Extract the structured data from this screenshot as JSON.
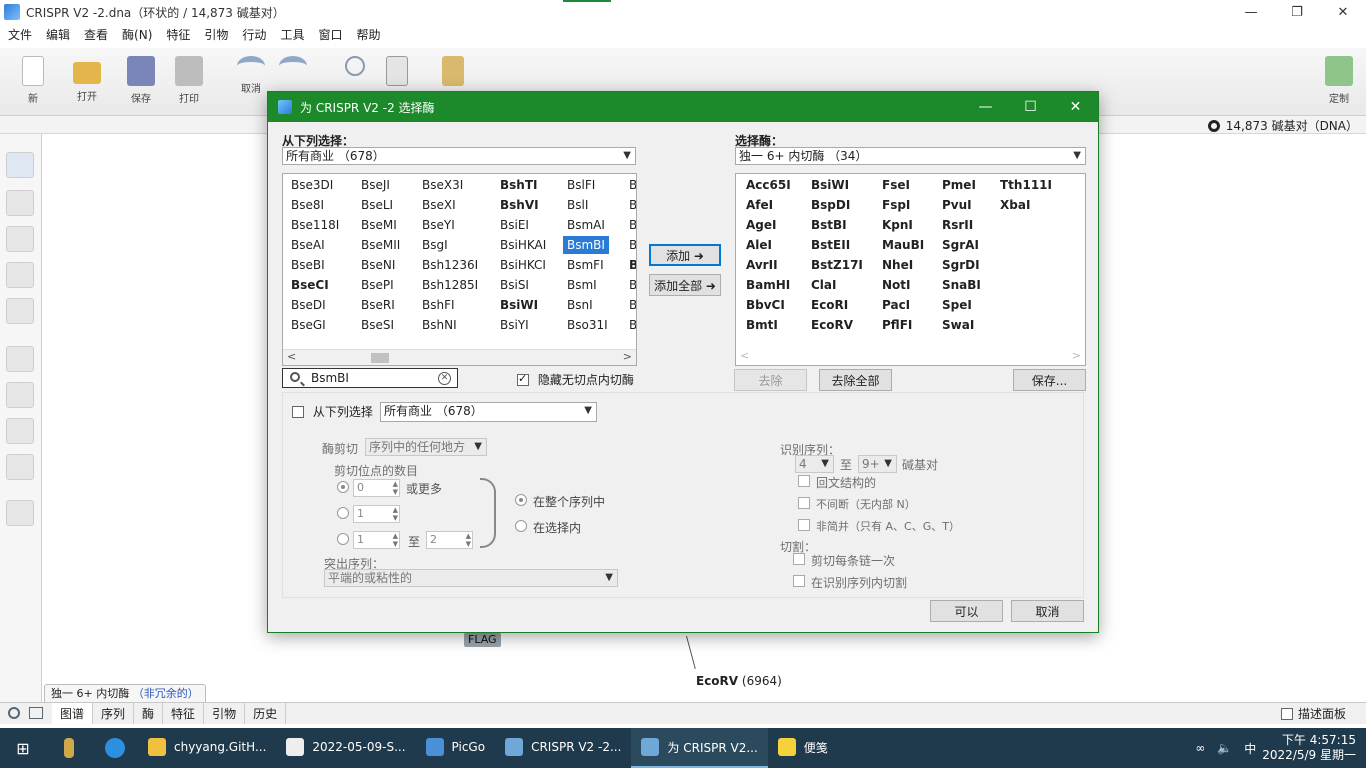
{
  "app": {
    "title": "CRISPR V2 -2.dna（环状的 / 14,873 碱基对）",
    "window_buttons": [
      "—",
      "❐",
      "✕"
    ]
  },
  "menu": [
    "文件",
    "编辑",
    "查看",
    "酶(N)",
    "特征",
    "引物",
    "行动",
    "工具",
    "窗口",
    "帮助"
  ],
  "toolbar": {
    "new": "新",
    "open": "打开",
    "save": "保存",
    "print": "打印",
    "undo": "取消",
    "redo": "",
    "cut": "",
    "copy": "",
    "paste": "",
    "customize": "定制"
  },
  "status": {
    "bp": "14,873 碱基对（DNA）"
  },
  "map": {
    "flag_label": "FLAG",
    "ecorv_name": "EcoRV",
    "ecorv_pos": "(6964)"
  },
  "enzyme_filter": {
    "text": "独一 6+ 内切酶",
    "link": "（非冗余的）"
  },
  "view_tabs": [
    "图谱",
    "序列",
    "酶",
    "特征",
    "引物",
    "历史"
  ],
  "describe_panel": "描述面板",
  "dialog": {
    "title": "为 CRISPR V2 -2 选择酶",
    "left_label": "从下列选择：",
    "left_combo": "所有商业  （678）",
    "right_label": "选择酶：",
    "right_combo": "独一 6+ 内切酶  （34）",
    "left_grid": [
      [
        {
          "t": "Bse3DI",
          "b": false
        },
        {
          "t": "BseJI",
          "b": false
        },
        {
          "t": "BseX3I",
          "b": false
        },
        {
          "t": "BshTI",
          "b": true
        },
        {
          "t": "BslFI",
          "b": false
        },
        {
          "t": "B",
          "b": false
        }
      ],
      [
        {
          "t": "Bse8I",
          "b": false
        },
        {
          "t": "BseLI",
          "b": false
        },
        {
          "t": "BseXI",
          "b": false
        },
        {
          "t": "BshVI",
          "b": true
        },
        {
          "t": "BslI",
          "b": false
        },
        {
          "t": "B",
          "b": false
        }
      ],
      [
        {
          "t": "Bse118I",
          "b": false
        },
        {
          "t": "BseMI",
          "b": false
        },
        {
          "t": "BseYI",
          "b": false
        },
        {
          "t": "BsiEI",
          "b": false
        },
        {
          "t": "BsmAI",
          "b": false
        },
        {
          "t": "B",
          "b": false
        }
      ],
      [
        {
          "t": "BseAI",
          "b": false
        },
        {
          "t": "BseMII",
          "b": false
        },
        {
          "t": "BsgI",
          "b": false
        },
        {
          "t": "BsiHKAI",
          "b": false
        },
        {
          "t": "BsmBI",
          "b": false,
          "sel": true
        },
        {
          "t": "B",
          "b": false
        }
      ],
      [
        {
          "t": "BseBI",
          "b": false
        },
        {
          "t": "BseNI",
          "b": false
        },
        {
          "t": "Bsh1236I",
          "b": false
        },
        {
          "t": "BsiHKCI",
          "b": false
        },
        {
          "t": "BsmFI",
          "b": false
        },
        {
          "t": "B",
          "b": true
        }
      ],
      [
        {
          "t": "BseCI",
          "b": true
        },
        {
          "t": "BsePI",
          "b": false
        },
        {
          "t": "Bsh1285I",
          "b": false
        },
        {
          "t": "BsiSI",
          "b": false
        },
        {
          "t": "BsmI",
          "b": false
        },
        {
          "t": "B",
          "b": false
        }
      ],
      [
        {
          "t": "BseDI",
          "b": false
        },
        {
          "t": "BseRI",
          "b": false
        },
        {
          "t": "BshFI",
          "b": false
        },
        {
          "t": "BsiWI",
          "b": true
        },
        {
          "t": "BsnI",
          "b": false
        },
        {
          "t": "B",
          "b": false
        }
      ],
      [
        {
          "t": "BseGI",
          "b": false
        },
        {
          "t": "BseSI",
          "b": false
        },
        {
          "t": "BshNI",
          "b": false
        },
        {
          "t": "BsiYI",
          "b": false
        },
        {
          "t": "Bso31I",
          "b": false
        },
        {
          "t": "B",
          "b": false
        }
      ]
    ],
    "right_grid": [
      [
        "Acc65I",
        "BsiWI",
        "FseI",
        "PmeI",
        "Tth111I"
      ],
      [
        "AfeI",
        "BspDI",
        "FspI",
        "PvuI",
        "XbaI"
      ],
      [
        "AgeI",
        "BstBI",
        "KpnI",
        "RsrII",
        ""
      ],
      [
        "AleI",
        "BstEII",
        "MauBI",
        "SgrAI",
        ""
      ],
      [
        "AvrII",
        "BstZ17I",
        "NheI",
        "SgrDI",
        ""
      ],
      [
        "BamHI",
        "ClaI",
        "NotI",
        "SnaBI",
        ""
      ],
      [
        "BbvCI",
        "EcoRI",
        "PacI",
        "SpeI",
        ""
      ],
      [
        "BmtI",
        "EcoRV",
        "PflFI",
        "SwaI",
        ""
      ]
    ],
    "add_button": "添加 ➜",
    "add_all_button": "添加全部 ➜",
    "search_value": "BsmBI",
    "hide_noncutters": "隐藏无切点内切酶",
    "remove_button": "去除",
    "remove_all_button": "去除全部",
    "save_button": "保存...",
    "choose_from": "从下列选择",
    "choose_combo": "所有商业  （678）",
    "enzyme_cut_label": "酶剪切",
    "enzyme_cut_value": "序列中的任何地方",
    "num_sites_label": "剪切位点的数目",
    "opt1_value": "0",
    "opt1_suffix": "或更多",
    "opt2_value": "1",
    "opt3_from": "1",
    "opt3_to_label": "至",
    "opt3_to": "2",
    "in_whole": "在整个序列中",
    "in_selection": "在选择内",
    "highlight_label": "突出序列：",
    "highlight_value": "平端的或粘性的",
    "recog_label": "识别序列：",
    "recog_from": "4",
    "recog_to_label": "至",
    "recog_to": "9+",
    "recog_unit": "碱基对",
    "palindromic": "回文结构的",
    "uninterrupted": "不间断（无内部 N）",
    "nondegenerate": "非简并（只有 A、C、G、T）",
    "cut_label": "切割：",
    "cut_once": "剪切每条链一次",
    "cut_within": "在识别序列内切割",
    "ok_button": "可以",
    "cancel_button": "取消"
  },
  "taskbar": {
    "tasks": [
      "chyyang.GitH...",
      "2022-05-09-S...",
      "PicGo",
      "CRISPR V2 -2...",
      "为 CRISPR V2...",
      "便笺"
    ],
    "ime": "中",
    "time": "下午 4:57:15",
    "date": "2022/5/9 星期一"
  }
}
